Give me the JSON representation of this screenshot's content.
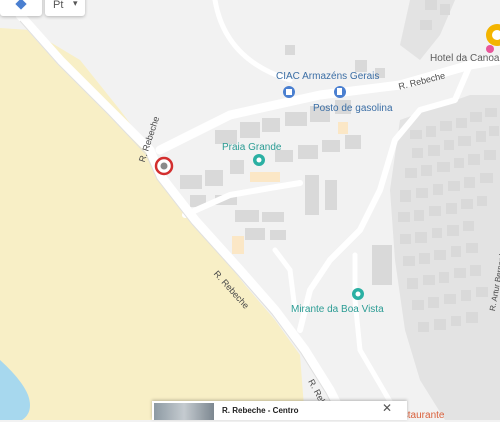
{
  "controls": {
    "language": "Pt",
    "dropdown_icon": "caret-down-icon",
    "directions_icon": "directions-icon"
  },
  "streets": {
    "north": "R. Rebeche",
    "curve": "R. Rebeche",
    "diagonal": "R. Rebeche",
    "south": "R. Reb",
    "vertical": "R. Artur Bernardes"
  },
  "places": {
    "hotel": "Hotel da Canoa",
    "warehouse": "CIAC Armazéns Gerais",
    "gas": "Posto de gasolina",
    "beach": "Praia Grande",
    "lookout": "Mirante da Boa Vista",
    "restaurant": "Restaurante"
  },
  "card": {
    "title": "R. Rebeche - Centro",
    "close_icon": "close-icon"
  },
  "colors": {
    "sand": "#f8efc6",
    "water": "#a7d8ee",
    "road": "#ffffff",
    "building": "#dcdcdc",
    "poi_blue": "#3b6ea5",
    "poi_teal": "#2b9c94",
    "pin": "#d32f2f",
    "hotel_pin": "#f3b400"
  }
}
